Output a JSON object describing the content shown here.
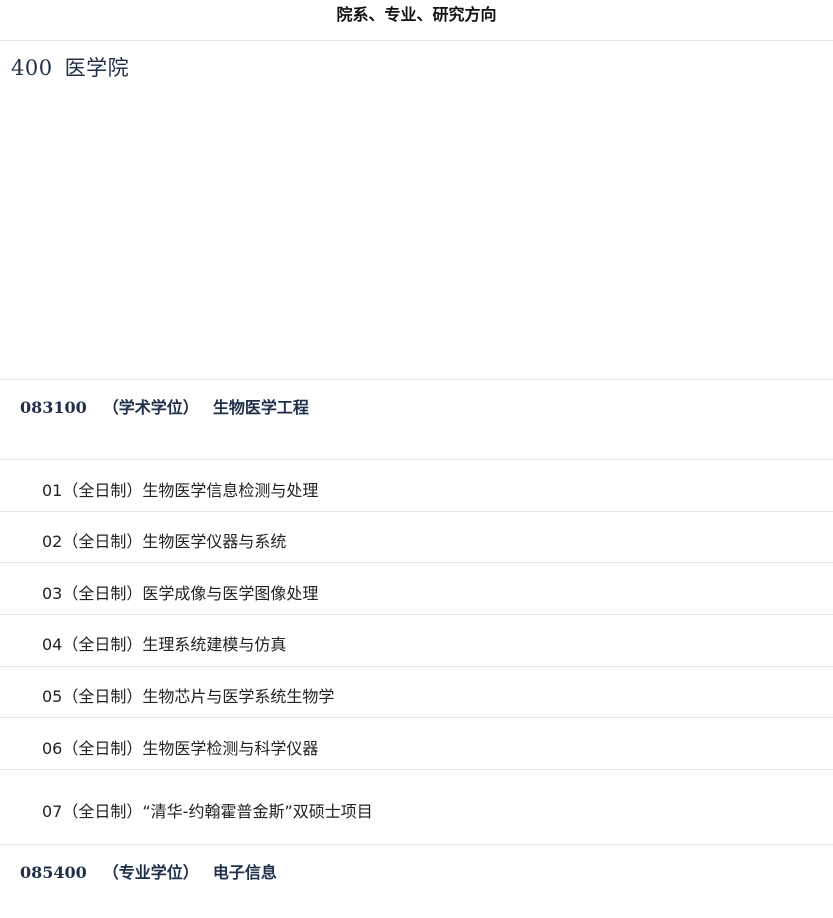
{
  "header": {
    "title": "院系、专业、研究方向"
  },
  "college": {
    "code": "400",
    "name": "医学院"
  },
  "majors": [
    {
      "code": "083100",
      "type": "（学术学位）",
      "name": "生物医学工程",
      "directions": [
        {
          "num": "01",
          "mode": "（全日制）",
          "name": "生物医学信息检测与处理"
        },
        {
          "num": "02",
          "mode": "（全日制）",
          "name": "生物医学仪器与系统"
        },
        {
          "num": "03",
          "mode": "（全日制）",
          "name": "医学成像与医学图像处理"
        },
        {
          "num": "04",
          "mode": "（全日制）",
          "name": "生理系统建模与仿真"
        },
        {
          "num": "05",
          "mode": "（全日制）",
          "name": "生物芯片与医学系统生物学"
        },
        {
          "num": "06",
          "mode": "（全日制）",
          "name": "生物医学检测与科学仪器"
        },
        {
          "num": "07",
          "mode": "（全日制）",
          "name": "“清华-约翰霍普金斯”双硕士项目"
        }
      ]
    },
    {
      "code": "085400",
      "type": "（专业学位）",
      "name": "电子信息",
      "directions": []
    }
  ]
}
